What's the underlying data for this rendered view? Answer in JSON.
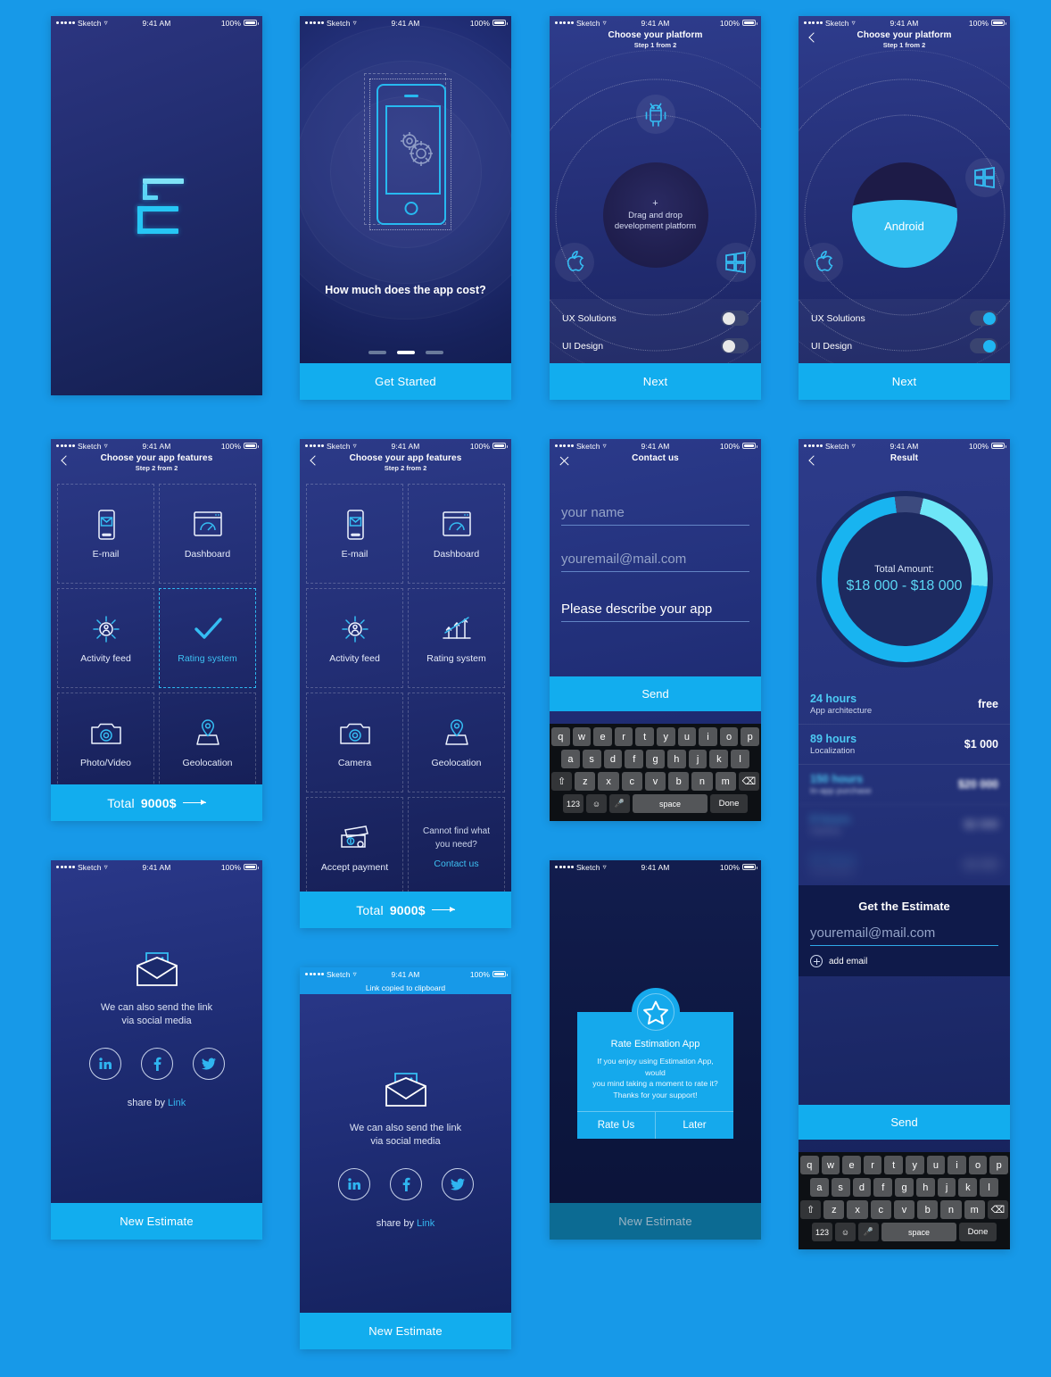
{
  "status_bar": {
    "carrier": "Sketch",
    "time": "9:41 AM",
    "battery": "100%"
  },
  "colors": {
    "accent": "#12adee",
    "cyan": "#3dc0f2",
    "bg_page": "#1799e8",
    "screen_bg": "#16255c"
  },
  "screens": {
    "splash": {
      "name": "splash"
    },
    "onboarding": {
      "title": "How much does the app cost?",
      "cta": "Get Started",
      "pager": [
        "",
        "",
        ""
      ],
      "active_dot": 1
    },
    "platform_empty": {
      "nav_title": "Choose your platform",
      "nav_sub": "Step 1 from 2",
      "center_plus": "+",
      "center_line1": "Drag and drop",
      "center_line2": "development platform",
      "nodes": [
        "android-icon",
        "apple-icon",
        "windows-icon"
      ],
      "toggles": [
        {
          "label": "UX Solutions",
          "on": false
        },
        {
          "label": "UI Design",
          "on": false
        }
      ],
      "cta": "Next"
    },
    "platform_selected": {
      "nav_title": "Choose your platform",
      "nav_sub": "Step 1 from 2",
      "selected_platform": "Android",
      "toggles": [
        {
          "label": "UX Solutions",
          "on": true
        },
        {
          "label": "UI Design",
          "on": true
        }
      ],
      "cta": "Next"
    },
    "features_6": {
      "nav_title": "Choose your app features",
      "nav_sub": "Step 2 from 2",
      "cells": [
        {
          "label": "E-mail",
          "icon": "email-phone-icon",
          "selected": false
        },
        {
          "label": "Dashboard",
          "icon": "dashboard-gauge-icon",
          "selected": false
        },
        {
          "label": "Activity feed",
          "icon": "activity-feed-icon",
          "selected": false
        },
        {
          "label": "Rating system",
          "icon": "check-icon",
          "selected": true
        },
        {
          "label": "Photo/Video",
          "icon": "camera-icon",
          "selected": false
        },
        {
          "label": "Geolocation",
          "icon": "map-pin-icon",
          "selected": false
        }
      ],
      "total_prefix": "Total",
      "total_value": "9000$"
    },
    "features_8": {
      "nav_title": "Choose your app features",
      "nav_sub": "Step 2 from 2",
      "cells": [
        {
          "label": "E-mail",
          "icon": "email-phone-icon"
        },
        {
          "label": "Dashboard",
          "icon": "dashboard-gauge-icon"
        },
        {
          "label": "Activity feed",
          "icon": "activity-feed-icon"
        },
        {
          "label": "Rating system",
          "icon": "growth-chart-icon"
        },
        {
          "label": "Camera",
          "icon": "camera-icon"
        },
        {
          "label": "Geolocation",
          "icon": "map-pin-icon"
        },
        {
          "label": "Accept payment",
          "icon": "money-icon"
        }
      ],
      "help_line1": "Cannot find what",
      "help_line2": "you need?",
      "help_link": "Contact us",
      "total_prefix": "Total",
      "total_value": "9000$"
    },
    "contact": {
      "nav_title": "Contact us",
      "name_placeholder": "your name",
      "email_placeholder": "youremail@mail.com",
      "description_value": "Please describe your app",
      "cta": "Send"
    },
    "result": {
      "nav_title": "Result",
      "donut_label": "Total Amount:",
      "donut_value": "$18 000 - $18 000",
      "rows": [
        {
          "hours": "24 hours",
          "name": "App architecture",
          "amount": "free",
          "blur": 0
        },
        {
          "hours": "89 hours",
          "name": "Localization",
          "amount": "$1 000",
          "blur": 0
        },
        {
          "hours": "150 hours",
          "name": "In-app purchase",
          "amount": "$20 000",
          "blur": 2.2
        },
        {
          "hours": "8 hours",
          "name": "Camera",
          "amount": "$2 000",
          "blur": 4.5
        },
        {
          "hours": "67 hours",
          "name": "Geolocation",
          "amount": "$3 000",
          "blur": 6.5
        }
      ],
      "estimate_title": "Get the Estimate",
      "email_placeholder": "youremail@mail.com",
      "add_email": "add email",
      "cta": "Send"
    },
    "share": {
      "line1": "We can also send the link",
      "line2": "via social media",
      "socials": [
        "linkedin-icon",
        "facebook-icon",
        "twitter-icon"
      ],
      "share_prefix": "share by",
      "share_link": "Link",
      "cta": "New Estimate"
    },
    "share_copied": {
      "toast": "Link copied to clipboard",
      "line1": "We can also send the link",
      "line2": "via social media",
      "share_prefix": "share by",
      "share_link": "Link",
      "cta": "New Estimate"
    },
    "rate": {
      "title": "Rate Estimation App",
      "body_line1": "If you enjoy using Estimation App, would",
      "body_line2": "you mind taking a moment to rate it?",
      "body_line3": "Thanks for your support!",
      "primary": "Rate Us",
      "secondary": "Later",
      "cta": "New Estimate"
    }
  },
  "keyboard": {
    "row1": [
      "q",
      "w",
      "e",
      "r",
      "t",
      "y",
      "u",
      "i",
      "o",
      "p"
    ],
    "row2": [
      "a",
      "s",
      "d",
      "f",
      "g",
      "h",
      "j",
      "k",
      "l"
    ],
    "row3": [
      "z",
      "x",
      "c",
      "v",
      "b",
      "n",
      "m"
    ],
    "shift": "⇧",
    "backspace": "⌫",
    "numbers": "123",
    "emoji": "☺",
    "mic": "🎤",
    "space": "space",
    "done": "Done"
  }
}
